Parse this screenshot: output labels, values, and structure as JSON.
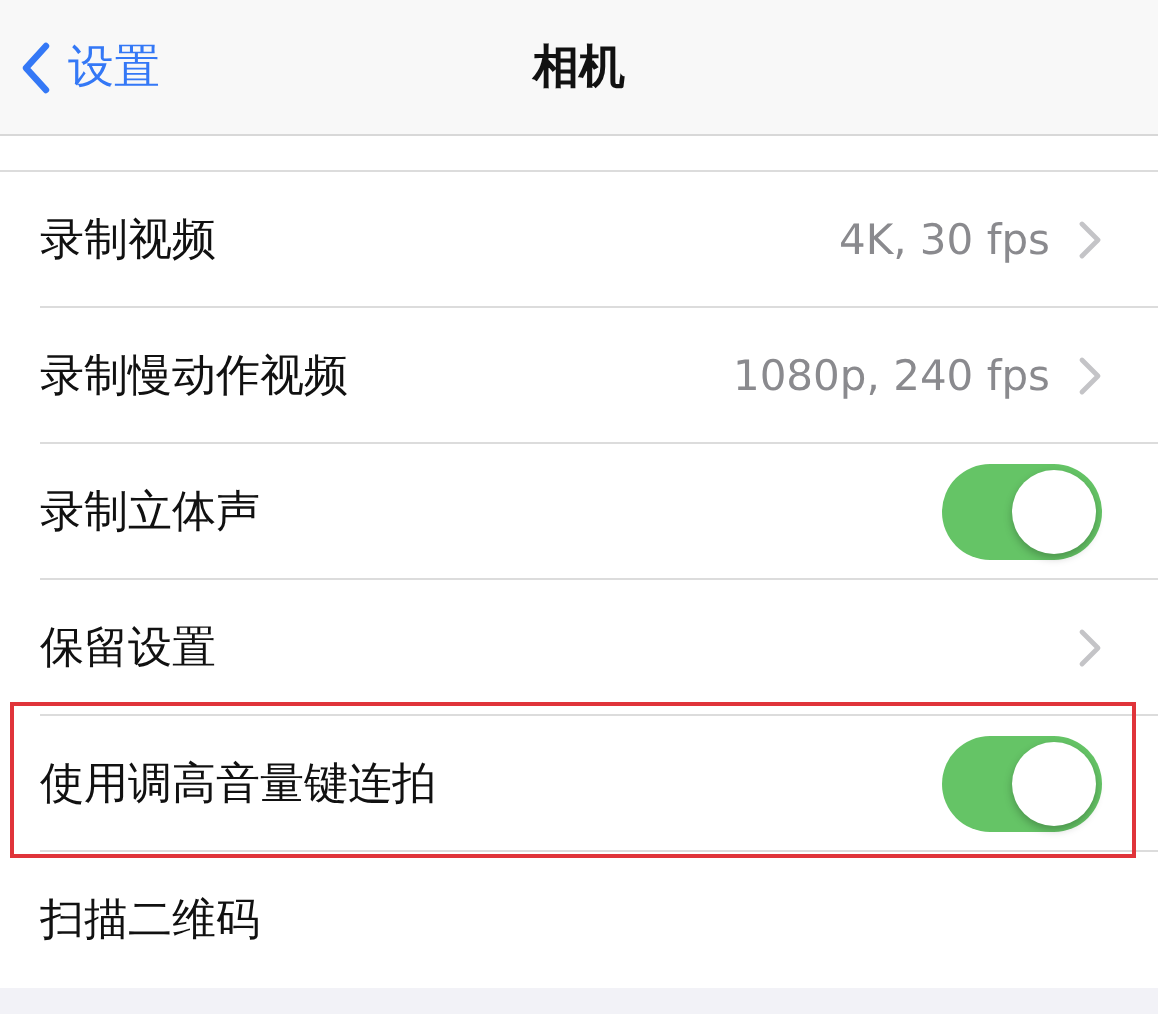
{
  "nav": {
    "back_label": "设置",
    "title": "相机"
  },
  "rows": [
    {
      "label": "录制视频",
      "kind": "link",
      "value": "4K, 30 fps",
      "highlighted": false
    },
    {
      "label": "录制慢动作视频",
      "kind": "link",
      "value": "1080p, 240 fps",
      "highlighted": false
    },
    {
      "label": "录制立体声",
      "kind": "toggle",
      "on": true,
      "highlighted": false
    },
    {
      "label": "保留设置",
      "kind": "link",
      "highlighted": false
    },
    {
      "label": "使用调高音量键连拍",
      "kind": "toggle",
      "on": true,
      "highlighted": true
    },
    {
      "label": "扫描二维码",
      "kind": "plain",
      "highlighted": false
    }
  ]
}
